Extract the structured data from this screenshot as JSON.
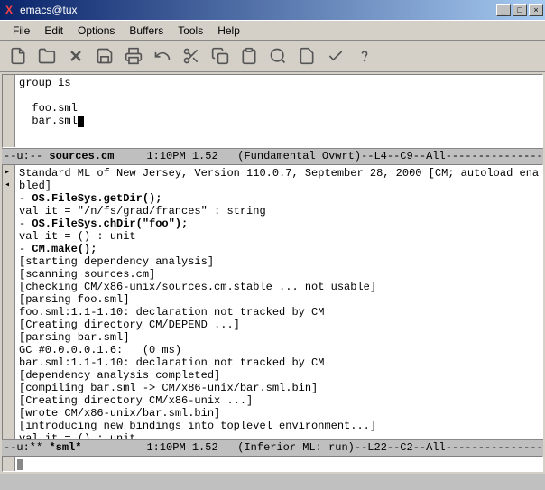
{
  "titlebar": {
    "title": "emacs@tux"
  },
  "menubar": {
    "items": [
      "File",
      "Edit",
      "Options",
      "Buffers",
      "Tools",
      "Help"
    ]
  },
  "pane_top": {
    "lines": [
      "group is",
      "",
      "  foo.sml",
      "  bar.sml"
    ]
  },
  "modeline_top": {
    "left": "--u:-- ",
    "buffer": "sources.cm",
    "rest": "     1:10PM 1.52   (Fundamental Ovwrt)--L4--C9--All-----------------"
  },
  "pane_bottom": {
    "line0": "Standard ML of New Jersey, Version 110.0.7, September 28, 2000 [CM; autoload ena",
    "line0b": "bled]",
    "l1p": "- ",
    "l1b": "OS.FileSys.getDir();",
    "l2": "val it = \"/n/fs/grad/frances\" : string",
    "l3p": "- ",
    "l3b": "OS.FileSys.chDir(\"foo\");",
    "l4": "val it = () : unit",
    "l5p": "- ",
    "l5b": "CM.make();",
    "l6": "[starting dependency analysis]",
    "l7": "[scanning sources.cm]",
    "l8": "[checking CM/x86-unix/sources.cm.stable ... not usable]",
    "l9": "[parsing foo.sml]",
    "l10": "foo.sml:1.1-1.10: declaration not tracked by CM",
    "l11": "[Creating directory CM/DEPEND ...]",
    "l12": "[parsing bar.sml]",
    "l13": "GC #0.0.0.0.1.6:   (0 ms)",
    "l14": "bar.sml:1.1-1.10: declaration not tracked by CM",
    "l15": "[dependency analysis completed]",
    "l16": "[compiling bar.sml -> CM/x86-unix/bar.sml.bin]",
    "l17": "[Creating directory CM/x86-unix ...]",
    "l18": "[wrote CM/x86-unix/bar.sml.bin]",
    "l19": "[introducing new bindings into toplevel environment...]",
    "l20": "val it = () : unit",
    "l21": "- "
  },
  "modeline_bottom": {
    "left": "--u:** ",
    "buffer": "*sml*",
    "rest": "          1:10PM 1.52   (Inferior ML: run)--L22--C2--All------------------"
  }
}
